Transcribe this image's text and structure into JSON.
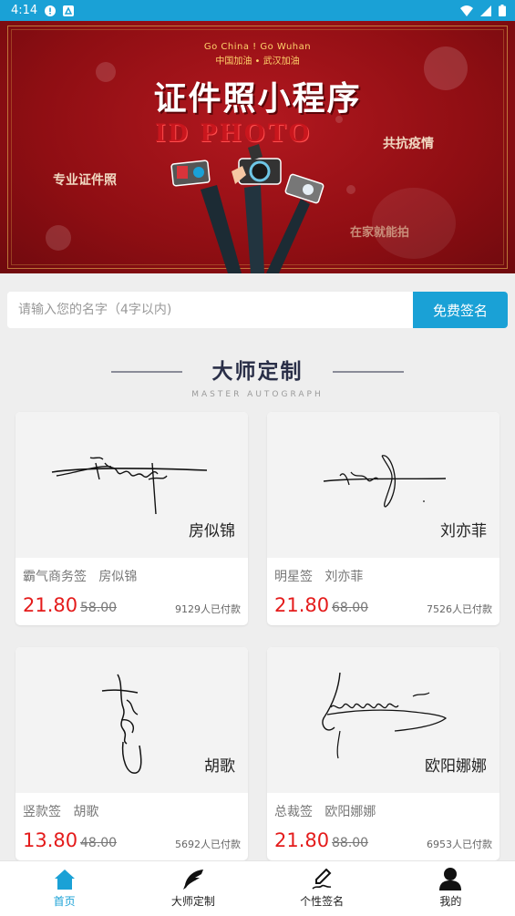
{
  "status_bar": {
    "time": "4:14"
  },
  "banner": {
    "en_slogan": "Go China ! Go Wuhan",
    "cn_slogan": "中国加油 • 武汉加油",
    "title": "证件照小程序",
    "id_photo": "ID PHOTO",
    "left_tag": "专业证件照",
    "right_tag_top": "共抗疫情",
    "right_tag_bottom": "在家就能拍"
  },
  "search": {
    "placeholder": "请输入您的名字（4字以内)",
    "value": "",
    "button": "免费签名"
  },
  "section": {
    "title": "大师定制",
    "subtitle": "MASTER AUTOGRAPH"
  },
  "cards": [
    {
      "name": "房似锦",
      "desc": "霸气商务签   房似锦",
      "price": "21.80",
      "orig": "58.00",
      "paid": "9129人已付款"
    },
    {
      "name": "刘亦菲",
      "desc": "明星签   刘亦菲",
      "price": "21.80",
      "orig": "68.00",
      "paid": "7526人已付款"
    },
    {
      "name": "胡歌",
      "desc": "竖款签   胡歌",
      "price": "13.80",
      "orig": "48.00",
      "paid": "5692人已付款"
    },
    {
      "name": "欧阳娜娜",
      "desc": "总裁签   欧阳娜娜",
      "price": "21.80",
      "orig": "88.00",
      "paid": "6953人已付款"
    }
  ],
  "tabbar": [
    {
      "label": "首页",
      "icon": "home-icon",
      "active": true
    },
    {
      "label": "大师定制",
      "icon": "quill-icon",
      "active": false
    },
    {
      "label": "个性签名",
      "icon": "pen-signature-icon",
      "active": false
    },
    {
      "label": "我的",
      "icon": "user-icon",
      "active": false
    }
  ],
  "colors": {
    "accent": "#1aa1d6",
    "price": "#e41b1b",
    "banner": "#a01217"
  }
}
